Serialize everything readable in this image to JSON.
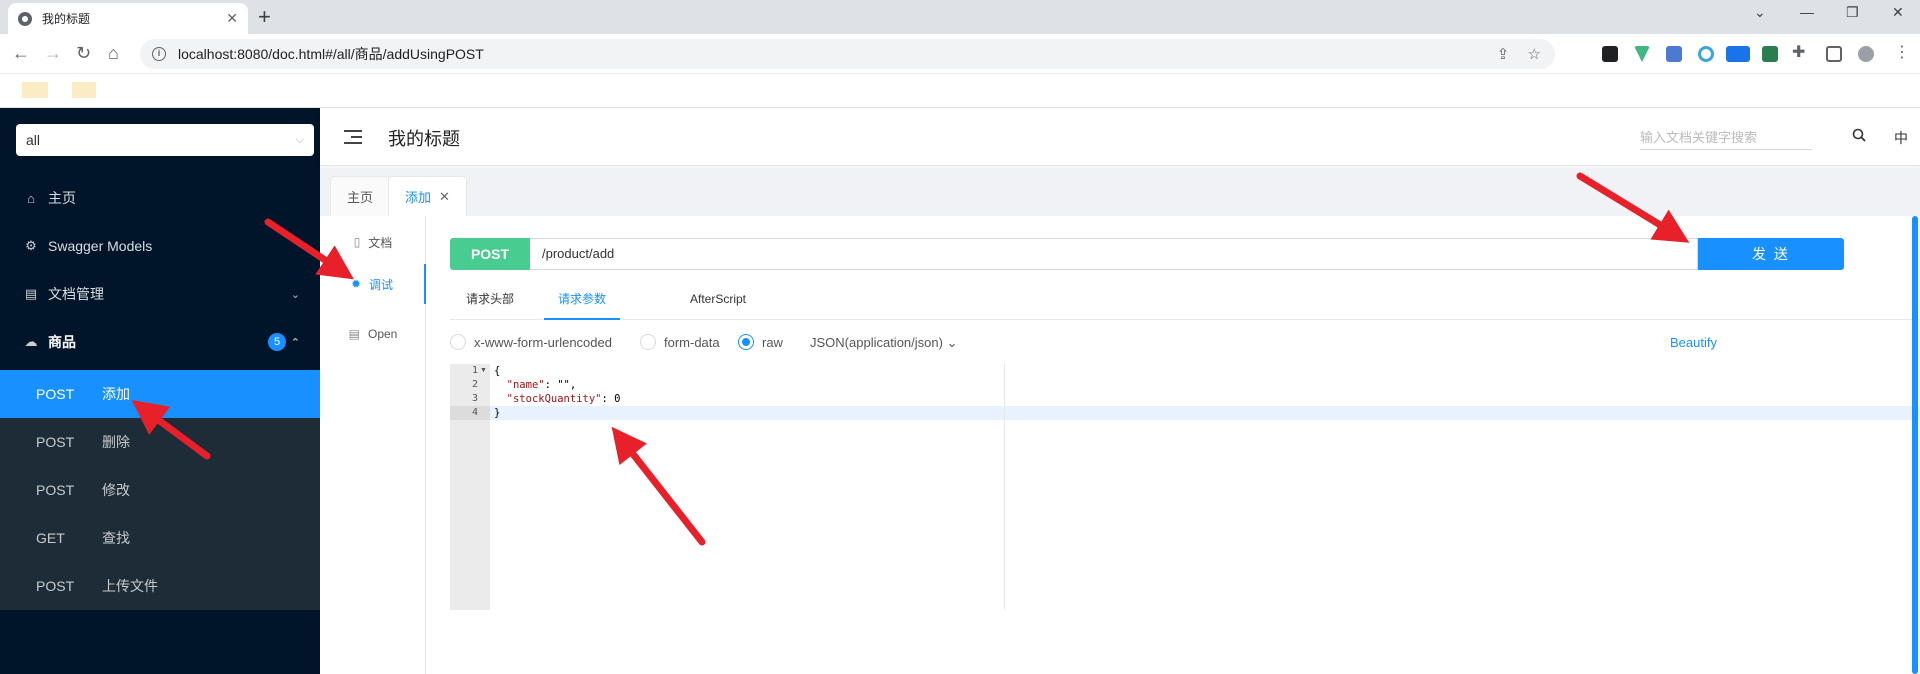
{
  "browser": {
    "tab_title": "我的标题",
    "tab_close": "✕",
    "new_tab": "+",
    "url": "localhost:8080/doc.html#/all/商品/addUsingPOST"
  },
  "sidebar": {
    "group_select": "all",
    "menu": [
      {
        "label": "主页",
        "icon": "home-icon"
      },
      {
        "label": "Swagger Models",
        "icon": "gear-icon"
      },
      {
        "label": "文档管理",
        "icon": "folder-icon"
      },
      {
        "label": "商品",
        "icon": "cloud-icon",
        "badge": "5"
      }
    ],
    "apis": [
      {
        "method": "POST",
        "label": "添加",
        "active": true
      },
      {
        "method": "POST",
        "label": "删除"
      },
      {
        "method": "POST",
        "label": "修改"
      },
      {
        "method": "GET",
        "label": "查找"
      },
      {
        "method": "POST",
        "label": "上传文件"
      }
    ]
  },
  "header": {
    "title": "我的标题",
    "search_placeholder": "输入文档关键字搜索",
    "lang": "中"
  },
  "doc_tabs": [
    {
      "label": "主页"
    },
    {
      "label": "添加",
      "active": true,
      "close": "✕"
    }
  ],
  "subnav": [
    {
      "label": "文档",
      "icon": "document-icon"
    },
    {
      "label": "调试",
      "icon": "bug-icon",
      "active": true
    },
    {
      "label": "Open",
      "icon": "file-icon"
    }
  ],
  "request": {
    "method": "POST",
    "path": "/product/add",
    "send": "发 送",
    "tabs": [
      "请求头部",
      "请求参数",
      "AfterScript"
    ],
    "active_tab": "请求参数",
    "body_types": [
      "x-www-form-urlencoded",
      "form-data",
      "raw"
    ],
    "selected_body_type": "raw",
    "content_type": "JSON(application/json)",
    "beautify": "Beautify"
  },
  "editor": {
    "line_numbers": [
      "1",
      "2",
      "3",
      "4"
    ],
    "lines": [
      {
        "text": "{"
      },
      {
        "key": "\"name\"",
        "rest": ": \"\","
      },
      {
        "key": "\"stockQuantity\"",
        "rest": ": 0"
      },
      {
        "text": "}"
      }
    ],
    "current_line": 4
  },
  "colors": {
    "sidebar_bg": "#001529",
    "accent": "#1890ff",
    "post_method": "#49cc90",
    "annotation_arrow": "#e8202a"
  }
}
